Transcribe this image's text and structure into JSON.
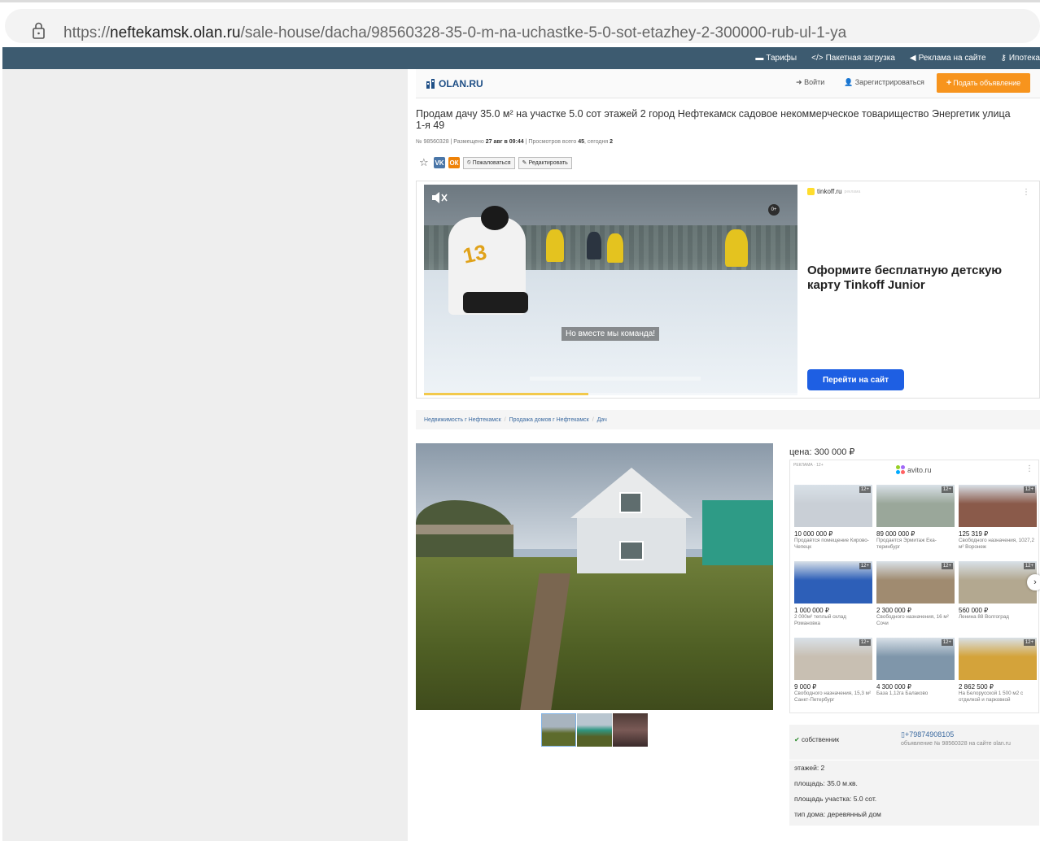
{
  "browser": {
    "url_prefix": "https://",
    "url_domain": "neftekamsk.olan.ru",
    "url_path": "/sale-house/dacha/98560328-35-0-m-na-uchastke-5-0-sot-etazhey-2-300000-rub-ul-1-ya"
  },
  "topnav": {
    "items": [
      "Тарифы",
      "Пакетная загрузка",
      "Реклама на сайте",
      "Ипотека"
    ]
  },
  "header": {
    "logo": "OLAN.RU",
    "login": "Войти",
    "register": "Зарегистрироваться",
    "post": "Подать объявление"
  },
  "listing": {
    "title": "Продам дачу 35.0 м² на участке 5.0 сот этажей 2 город Нефтекамск садовое некоммерческое товарищество Энергетик улица 1-я 49",
    "meta_prefix": "№ 98560328 | Размещено ",
    "meta_date": "27 авг в 09:44",
    "meta_views": " | Просмотров всего ",
    "views_total": "45",
    "meta_today": ", сегодня ",
    "views_today": "2",
    "complain": "Пожаловаться",
    "edit": "Редактировать",
    "vk": "VK",
    "ok": "ОК"
  },
  "ad": {
    "source": "tinkoff.ru",
    "label": "реклама",
    "headline": "Оформите бесплатную детскую карту Tinkoff Junior",
    "button": "Перейти на сайт",
    "caption": "Но вместе мы команда!",
    "age": "0+",
    "jersey": "13",
    "progress": 0.44
  },
  "breadcrumbs": [
    "Недвижимость г Нефтекамск",
    "Продажа домов г Нефтекамск",
    "Дач"
  ],
  "price": "цена: 300 000 ₽",
  "avito": {
    "tag": "РЕКЛАМА · 12+",
    "source": "avito.ru",
    "cards": [
      {
        "price": "10 000 000 ₽",
        "desc": "Продаётся помещение Кирово-Чепецк",
        "badge": "12+",
        "color": "#c9cfd6"
      },
      {
        "price": "89 000 000 ₽",
        "desc": "Продается Эрмитаж Ека-теринбург",
        "badge": "12+",
        "color": "#9aa79a"
      },
      {
        "price": "125 319 ₽",
        "desc": "Свободного назначения, 1027,2 м² Воронеж",
        "badge": "12+",
        "color": "#8a5a4a"
      },
      {
        "price": "1 000 000 ₽",
        "desc": "2 000м² теплый склад Романовка",
        "badge": "12+",
        "color": "#2d5fb8"
      },
      {
        "price": "2 300 000 ₽",
        "desc": "Свободного назначения, 16 м² Сочи",
        "badge": "12+",
        "color": "#a08b70"
      },
      {
        "price": "560 000 ₽",
        "desc": "Ленина 88 Волгоград",
        "badge": "12+",
        "color": "#b3a890"
      },
      {
        "price": "9 000 ₽",
        "desc": "Свободного назначения, 15,3 м² Санкт-Петербург",
        "badge": "12+",
        "color": "#c8bfb2"
      },
      {
        "price": "4 300 000 ₽",
        "desc": "База 1,12га Балаково",
        "badge": "12+",
        "color": "#7f96aa"
      },
      {
        "price": "2 862 500 ₽",
        "desc": "На Белорусской 1 500 м2 с отделкой и парковкой",
        "badge": "12+",
        "color": "#d4a33a"
      }
    ]
  },
  "owner": {
    "check": "✔",
    "label": "собственник",
    "phone": "+79874908105",
    "note": "объявление № 98560328 на сайте olan.ru"
  },
  "props": [
    "этажей: 2",
    "площадь: 35.0 м.кв.",
    "площадь участка: 5.0 сот.",
    "тип дома: деревянный дом"
  ],
  "colors": {
    "accent": "#f7941d",
    "nav": "#3d5b70",
    "ad_button": "#1e5fe3"
  }
}
